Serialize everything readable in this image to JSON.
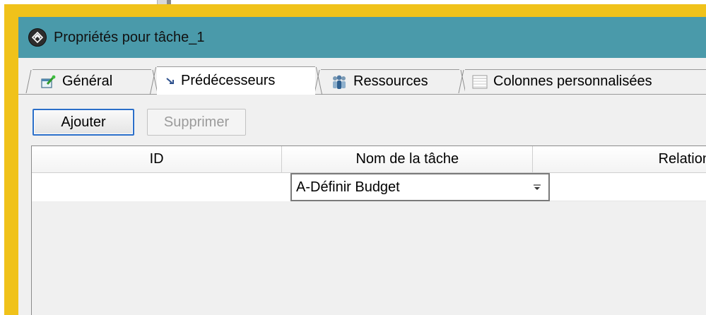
{
  "window": {
    "title": "Propriétés pour tâche_1"
  },
  "tabs": [
    {
      "label": "Général",
      "icon": "task-properties-icon"
    },
    {
      "label": "Prédécesseurs",
      "icon": "predecessor-arrow-icon",
      "selected": true
    },
    {
      "label": "Ressources",
      "icon": "resources-people-icon"
    },
    {
      "label": "Colonnes personnalisées",
      "icon": "table-columns-icon"
    }
  ],
  "toolbar": {
    "add_label": "Ajouter",
    "delete_label": "Supprimer"
  },
  "grid": {
    "columns": [
      "ID",
      "Nom de la tâche",
      "Relation"
    ],
    "rows": [
      {
        "id": "",
        "name": "A-Définir Budget",
        "relation": ""
      }
    ]
  },
  "colors": {
    "titlebar": "#4a9aaa",
    "frame": "#f0c21a",
    "focus_border": "#2b6fc9",
    "panel": "#f0f0f0"
  }
}
